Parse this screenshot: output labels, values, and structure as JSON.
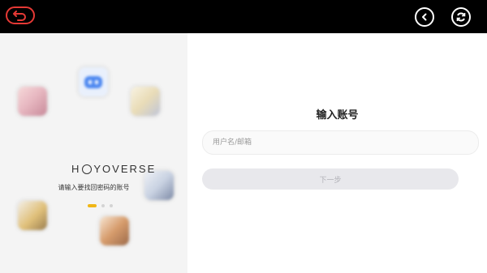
{
  "topbar": {
    "back_icon": "back-arrow-icon",
    "left_icon": "chevron-left-icon",
    "refresh_icon": "refresh-icon",
    "back_color": "#e53935"
  },
  "left_panel": {
    "logo_text_prefix": "H",
    "logo_text_suffix": "YOVERSE",
    "subtitle": "请输入要找回密码的账号",
    "carousel_pages": 3,
    "active_page": 1,
    "accent_color": "#f0b616"
  },
  "form": {
    "title": "输入账号",
    "account_placeholder": "用户名/邮箱",
    "account_value": "",
    "next_label": "下一步"
  }
}
